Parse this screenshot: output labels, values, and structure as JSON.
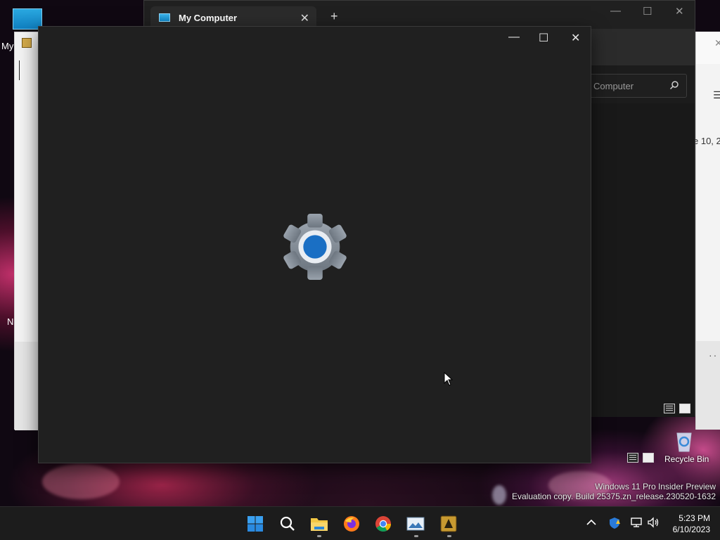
{
  "desktop": {
    "my_computer_label": "My",
    "partial_label_n": "N",
    "recycle_bin_label": "Recycle Bin",
    "watermark_line1": "Windows 11 Pro Insider Preview",
    "watermark_line2": "Evaluation copy. Build 25375.zn_release.230520-1632"
  },
  "explorer": {
    "tab_title": "My Computer",
    "tab_close": "✕",
    "new_tab": "+",
    "minimize": "—",
    "maximize": "☐",
    "close": "✕",
    "search_placeholder": "Computer"
  },
  "right_window": {
    "partial_date": "e 10, 2",
    "menu_glyph": "☰",
    "close": "✕",
    "dots": "··"
  },
  "main_window": {
    "minimize": "—",
    "maximize": "☐",
    "close": "✕",
    "accent_color": "#1a6fc4"
  },
  "taskbar": {
    "time": "5:23 PM",
    "date": "6/10/2023",
    "icons": [
      "start-icon",
      "search-icon",
      "file-explorer-icon",
      "firefox-icon",
      "chrome-icon",
      "photo-viewer-icon",
      "app-icon"
    ],
    "tray": [
      "chevron-up-icon",
      "security-icon",
      "network-icon",
      "volume-icon"
    ]
  }
}
